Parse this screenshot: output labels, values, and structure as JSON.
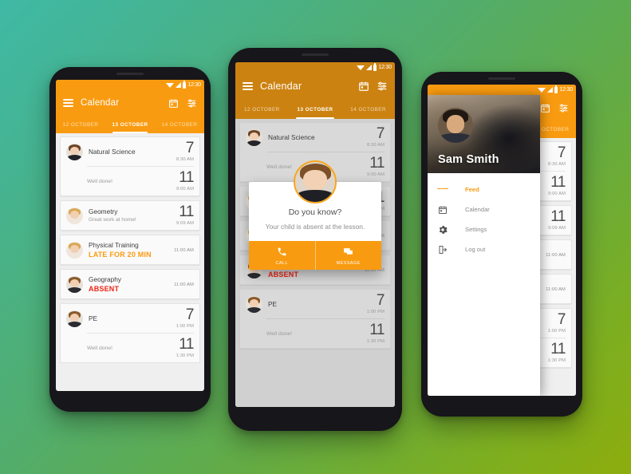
{
  "status_bar": {
    "time": "12:30",
    "icons": [
      "wifi-icon",
      "signal-icon",
      "battery-icon"
    ]
  },
  "toolbar": {
    "title": "Calendar",
    "menu_icon": "hamburger-menu-icon",
    "calendar_icon": "calendar-icon",
    "filter_icon": "filter-icon"
  },
  "tabs": [
    {
      "label": "12 OCTOBER",
      "active": false
    },
    {
      "label": "13 OCTOBER",
      "active": true
    },
    {
      "label": "14 OCTOBER",
      "active": false
    }
  ],
  "lessons": [
    {
      "subject": "Natural Science",
      "avatar": "boy-avatar",
      "grade": "7",
      "time": "8:30 AM",
      "sub_note": "Well done!",
      "sub_grade": "11",
      "sub_time": "9:00 AM"
    },
    {
      "subject": "Geometry",
      "avatar": "girl-avatar",
      "note": "Great work at home!",
      "grade": "11",
      "time": "9:09 AM"
    },
    {
      "subject": "Physical Training",
      "avatar": "girl-avatar",
      "status": "LATE FOR 20 MIN",
      "status_kind": "late",
      "time": "11:00 AM"
    },
    {
      "subject": "Geography",
      "avatar": "boy2-avatar",
      "status": "ABSENT",
      "status_kind": "absent",
      "time": "11:00 AM"
    },
    {
      "subject": "PE",
      "avatar": "boy2-avatar",
      "grade": "7",
      "time": "1:00 PM",
      "sub_note": "Well done!",
      "sub_grade": "11",
      "sub_time": "1:30 PM"
    }
  ],
  "dialog": {
    "avatar": "child-avatar",
    "title": "Do you know?",
    "message": "Your child is absent at the lesson.",
    "buttons": [
      {
        "label": "CALL",
        "icon": "phone-icon"
      },
      {
        "label": "MESSAGE",
        "icon": "message-icon"
      }
    ]
  },
  "drawer": {
    "user_name": "Sam Smith",
    "avatar": "user-avatar",
    "items": [
      {
        "label": "Feed",
        "icon": "feed-list-icon",
        "active": true
      },
      {
        "label": "Calendar",
        "icon": "calendar-icon",
        "active": false
      },
      {
        "label": "Settings",
        "icon": "gear-icon",
        "active": false
      },
      {
        "label": "Log out",
        "icon": "logout-icon",
        "active": false
      }
    ]
  },
  "colors": {
    "accent": "#f99b10",
    "absent": "#ef2414",
    "background_start": "#3fb9a5",
    "background_end": "#8dad0d"
  }
}
